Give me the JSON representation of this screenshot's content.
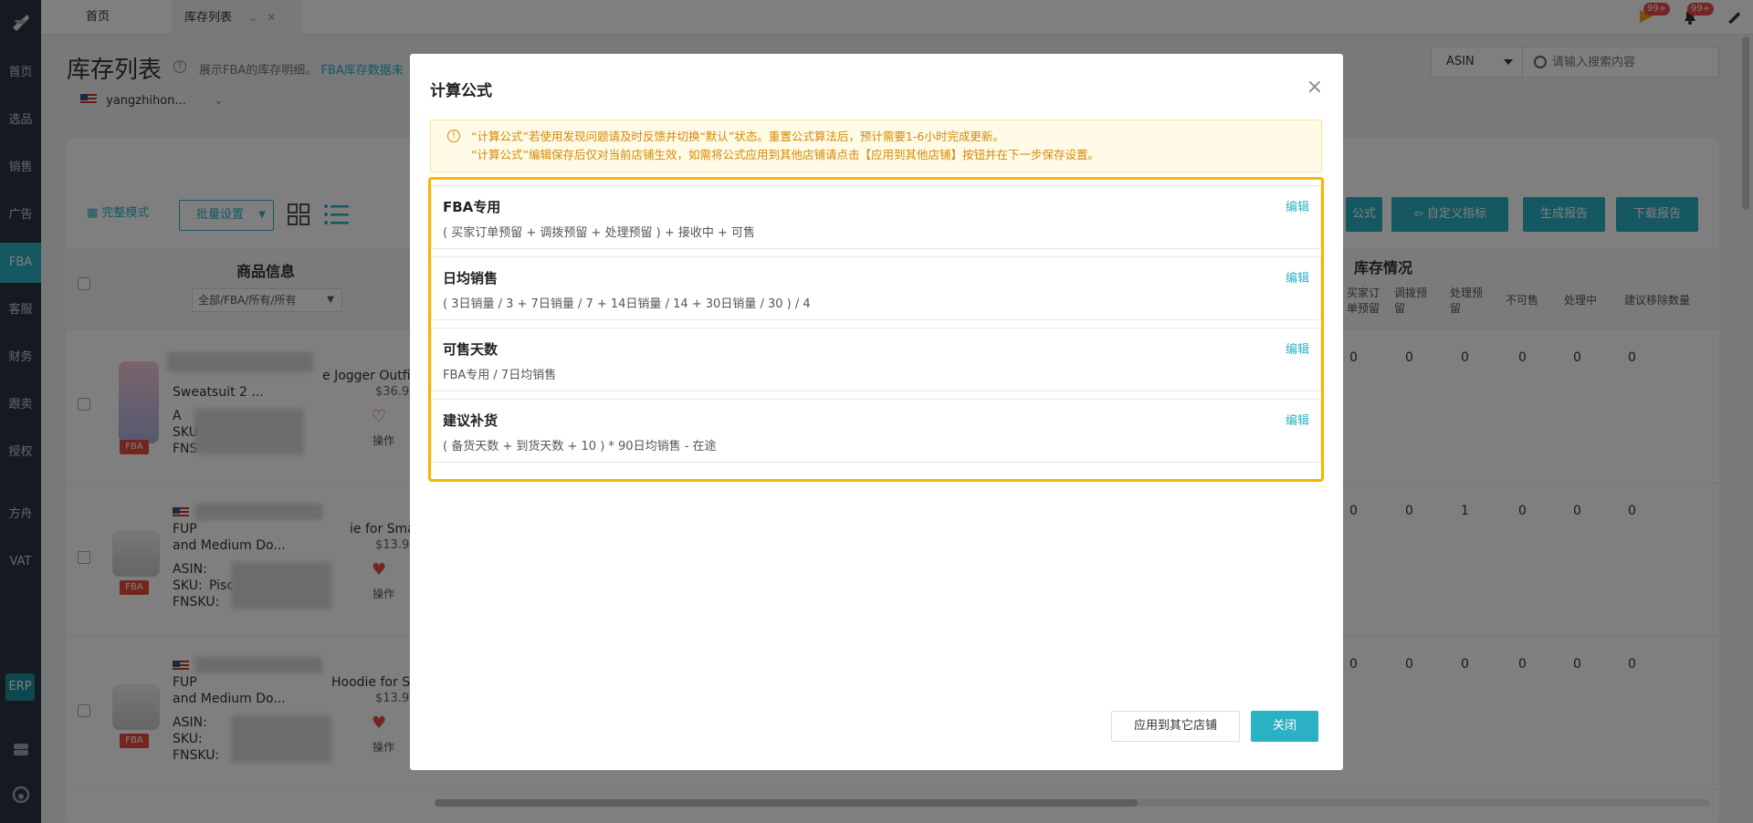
{
  "sidebar": {
    "items": [
      {
        "label": "首页"
      },
      {
        "label": "选品"
      },
      {
        "label": "销售"
      },
      {
        "label": "广告"
      },
      {
        "label": "FBA"
      },
      {
        "label": "客服"
      },
      {
        "label": "财务"
      },
      {
        "label": "跟卖"
      },
      {
        "label": "授权"
      },
      {
        "label": "方舟"
      },
      {
        "label": "VAT"
      }
    ],
    "erp_label": "ERP",
    "active": "FBA"
  },
  "tabs": [
    {
      "label": "首页"
    },
    {
      "label": "库存列表"
    }
  ],
  "notifications": {
    "flag_count": "99+",
    "bell_count": "99+"
  },
  "page": {
    "title": "库存列表",
    "subtitle": "展示FBA的库存明细。",
    "subtitle_link": "FBA库存数据未",
    "store": "yangzhihon..."
  },
  "search": {
    "type": "ASIN",
    "placeholder": "请输入搜索内容"
  },
  "toolbar": {
    "mode": "完整模式",
    "bulk": "批量设置",
    "formula_btn": "公式",
    "custom_btn": "自定义指标",
    "report_btn": "生成报告",
    "download_btn": "下载报告"
  },
  "table": {
    "product_header": "商品信息",
    "filter": "全部/FBA/所有/所有",
    "stock_header": "库存情况",
    "stock_cols": [
      "买家订单预留",
      "调拨预留",
      "处理预留",
      "不可售",
      "处理中",
      "建议移除数量"
    ],
    "rows": [
      {
        "title_a": "Sweatsuit 2 ...",
        "title_b": "e Jogger Outfit",
        "price": "$36.9",
        "asin_label": "A",
        "sku_label": "SKU:",
        "fnsku_label": "FNS",
        "tag": "FBA",
        "op": "操作",
        "values": [
          "0",
          "0",
          "0",
          "0",
          "0",
          "0"
        ]
      },
      {
        "title_a": "FUP",
        "title_b": "ie for Small",
        "title_c": "and Medium Do...",
        "price": "$13.9",
        "asin_label": "ASIN:",
        "sku_label": "SKU:",
        "sku_val": "Pisc",
        "fnsku_label": "FNSKU:",
        "tag": "FBA",
        "op": "操作",
        "values": [
          "0",
          "0",
          "1",
          "0",
          "0",
          "0"
        ]
      },
      {
        "title_a": "FUP",
        "title_b": "Hoodie for Small",
        "title_c": "and Medium Do...",
        "price": "$13.9",
        "asin_label": "ASIN:",
        "sku_label": "SKU:",
        "fnsku_label": "FNSKU:",
        "tag": "FBA",
        "op": "操作",
        "values": [
          "0",
          "0",
          "0",
          "0",
          "0",
          "0"
        ]
      }
    ]
  },
  "modal": {
    "title": "计算公式",
    "alert_line1": "“计算公式”若使用发现问题请及时反馈并切换“默认”状态。重置公式算法后，预计需要1-6小时完成更新。",
    "alert_line2": "“计算公式”编辑保存后仅对当前店铺生效，如需将公式应用到其他店铺请点击【应用到其他店铺】按钮并在下一步保存设置。",
    "edit_label": "编辑",
    "formulas": [
      {
        "name": "FBA专用",
        "expr": "( 买家订单预留 + 调拨预留 + 处理预留 ) + 接收中 + 可售"
      },
      {
        "name": "日均销售",
        "expr": "( 3日销量 / 3 + 7日销量 / 7 + 14日销量 / 14 + 30日销量 / 30 ) / 4"
      },
      {
        "name": "可售天数",
        "expr": "FBA专用 / 7日均销售"
      },
      {
        "name": "建议补货",
        "expr": "( 备货天数 + 到货天数 + 10 ) * 90日均销售 - 在途"
      }
    ],
    "apply_btn": "应用到其它店铺",
    "close_btn": "关闭"
  }
}
